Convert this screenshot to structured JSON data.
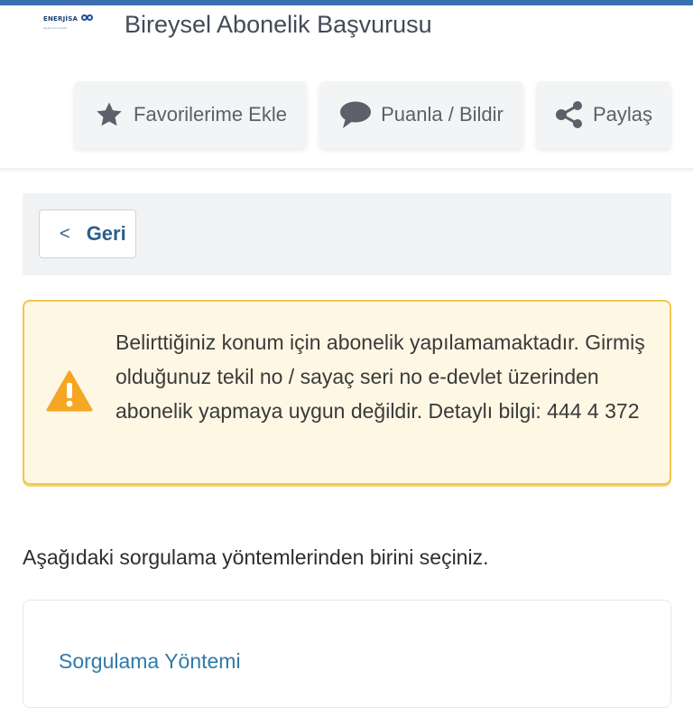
{
  "header": {
    "logo_text": "ENERJİSA",
    "logo_tagline": "hayatımızın enerjisi",
    "page_title": "Bireysel Abonelik Başvurusu"
  },
  "actions": [
    {
      "label": "Favorilerime Ekle",
      "icon": "star-icon"
    },
    {
      "label": "Puanla / Bildir",
      "icon": "speech-bubble-icon"
    },
    {
      "label": "Paylaş",
      "icon": "share-icon"
    }
  ],
  "back": {
    "label": "Geri",
    "icon": "chevron-left-icon",
    "chevron": "<"
  },
  "warning": {
    "icon": "warning-triangle-icon",
    "message": "Belirttiğiniz konum için abonelik yapılamamaktadır. Girmiş olduğunuz tekil no / sayaç seri no e-devlet üzerinden abonelik yapmaya uygun değildir. Detaylı bilgi: 444 4 372"
  },
  "instruction": "Aşağıdaki sorgulama yöntemlerinden birini seçiniz.",
  "method_card": {
    "title": "Sorgulama Yöntemi"
  },
  "colors": {
    "accent": "#2c5f8a",
    "link": "#2f7aa8",
    "warning_bg": "#fef7e4",
    "warning_border": "#f2c64d",
    "warning_icon": "#f5a623"
  }
}
